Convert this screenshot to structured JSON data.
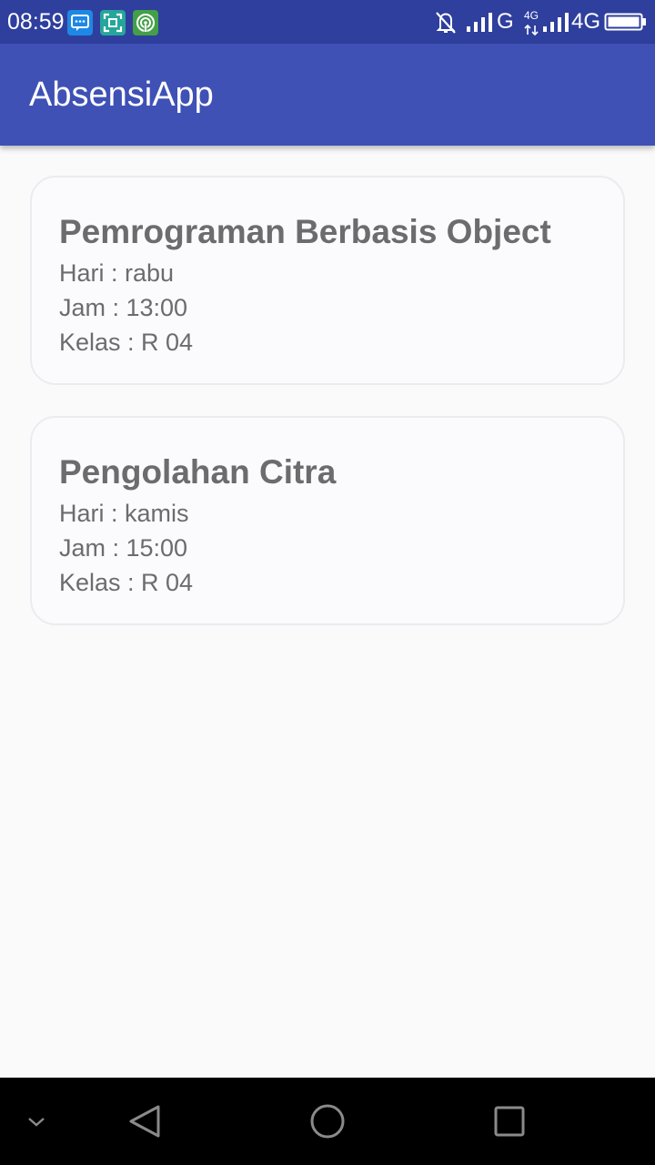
{
  "status_bar": {
    "time": "08:59",
    "network_1": "G",
    "network_2": "4G",
    "network_2_small": "4G",
    "icons": [
      "message-icon",
      "scan-icon",
      "hotspot-icon",
      "bell-off-icon",
      "signal-icon",
      "signal-icon",
      "battery-icon"
    ]
  },
  "app_bar": {
    "title": "AbsensiApp"
  },
  "courses": [
    {
      "title": "Pemrograman Berbasis Object",
      "day": "Hari : rabu",
      "time": "Jam : 13:00",
      "room": "Kelas : R 04"
    },
    {
      "title": "Pengolahan Citra",
      "day": "Hari : kamis",
      "time": "Jam : 15:00",
      "room": "Kelas : R 04"
    }
  ],
  "nav_bar": {
    "icons": [
      "chevron-down-icon",
      "back-icon",
      "home-icon",
      "recents-icon"
    ]
  },
  "colors": {
    "status_bar": "#2f3f9e",
    "app_bar": "#3f51b5",
    "background": "#fafafa",
    "card_text": "#6c6c70"
  }
}
